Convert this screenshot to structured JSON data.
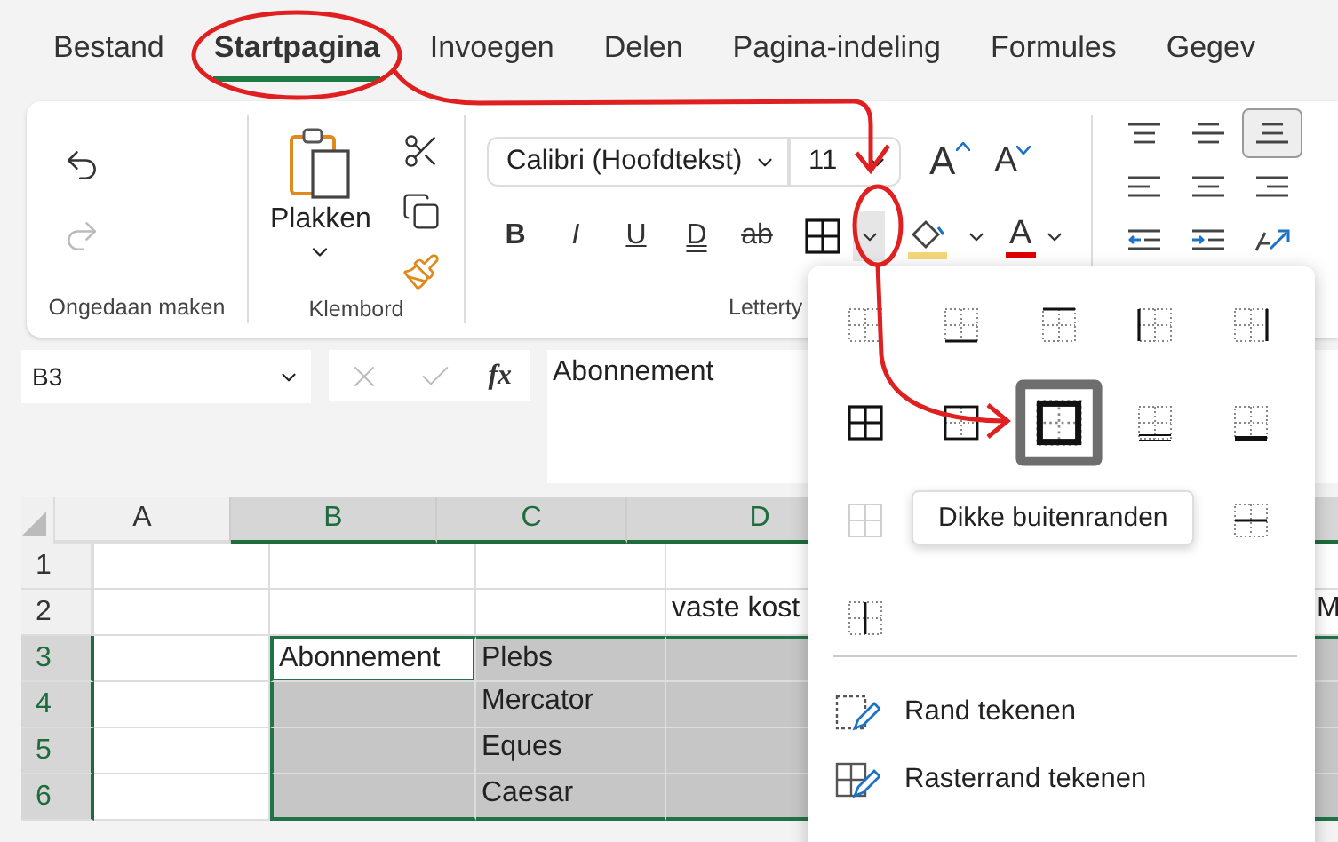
{
  "tabs": [
    {
      "label": "Bestand",
      "selected": false
    },
    {
      "label": "Startpagina",
      "selected": true
    },
    {
      "label": "Invoegen",
      "selected": false
    },
    {
      "label": "Delen",
      "selected": false
    },
    {
      "label": "Pagina-indeling",
      "selected": false
    },
    {
      "label": "Formules",
      "selected": false
    },
    {
      "label": "Gegev",
      "selected": false
    }
  ],
  "ribbon": {
    "undo_group": {
      "label": "Ongedaan maken",
      "actions": [
        {
          "kind": "undo",
          "disabled": false
        },
        {
          "kind": "redo",
          "disabled": true
        }
      ]
    },
    "clipboard_group": {
      "label": "Klembord",
      "paste": "Plakken"
    },
    "font_group": {
      "label": "Letterty",
      "font_name": "Calibri (Hoofdtekst)",
      "font_size": "11",
      "grow": "A",
      "shrink": "A",
      "font_color": "A",
      "border_menu_open": true,
      "styles": [
        {
          "kind": "bold",
          "text": "B"
        },
        {
          "kind": "italic",
          "text": "I"
        },
        {
          "kind": "underline",
          "text": "U"
        },
        {
          "kind": "double_underline",
          "text": "D"
        },
        {
          "kind": "strikethrough",
          "text": "ab"
        }
      ]
    },
    "alignment_group": {
      "buttons": [
        {
          "kind": "top",
          "selected": false
        },
        {
          "kind": "middle",
          "selected": false
        },
        {
          "kind": "bottom",
          "selected": true
        },
        {
          "kind": "left",
          "selected": false
        },
        {
          "kind": "center",
          "selected": false
        },
        {
          "kind": "right",
          "selected": false
        },
        {
          "kind": "indent_decrease",
          "selected": false
        },
        {
          "kind": "indent_increase",
          "selected": false
        },
        {
          "kind": "orientation",
          "selected": false
        }
      ]
    }
  },
  "formula_bar": {
    "name_box": "B3",
    "function_label": "fx",
    "formula": "Abonnement"
  },
  "sheet": {
    "columns": [
      {
        "label": "A",
        "selected": false
      },
      {
        "label": "B",
        "selected": true
      },
      {
        "label": "C",
        "selected": true
      },
      {
        "label": "D",
        "selected": true
      },
      {
        "selected": true
      }
    ],
    "rows": [
      {
        "label": "1",
        "selected": false,
        "cells": [
          {
            "active": false
          },
          {
            "active": false
          },
          {
            "active": false
          },
          {
            "active": false
          },
          {
            "active": false
          }
        ]
      },
      {
        "label": "2",
        "selected": false,
        "cells": [
          {
            "active": false
          },
          {
            "active": false
          },
          {
            "active": false
          },
          {
            "text": "vaste kost",
            "active": false
          },
          {
            "text": "M",
            "active": false
          }
        ]
      },
      {
        "label": "3",
        "selected": true,
        "cells": [
          {
            "active": false
          },
          {
            "text": "Abonnement",
            "active": true
          },
          {
            "text": "Plebs",
            "active": false
          },
          {
            "active": false
          },
          {
            "active": false
          }
        ]
      },
      {
        "label": "4",
        "selected": true,
        "cells": [
          {
            "active": false
          },
          {
            "active": false
          },
          {
            "text": "Mercator",
            "active": false
          },
          {
            "active": false
          },
          {
            "active": false
          }
        ]
      },
      {
        "label": "5",
        "selected": true,
        "cells": [
          {
            "active": false
          },
          {
            "active": false
          },
          {
            "text": "Eques",
            "active": false
          },
          {
            "active": false
          },
          {
            "active": false
          }
        ]
      },
      {
        "label": "6",
        "selected": true,
        "cells": [
          {
            "active": false
          },
          {
            "active": false
          },
          {
            "text": "Caesar",
            "active": false
          },
          {
            "active": false
          },
          {
            "active": false
          }
        ]
      }
    ]
  },
  "border_menu": {
    "rows": [
      [
        {
          "kind": "none",
          "selected": false,
          "disabled": false
        },
        {
          "kind": "bottom",
          "selected": false,
          "disabled": false
        },
        {
          "kind": "top",
          "selected": false,
          "disabled": false
        },
        {
          "kind": "left",
          "selected": false,
          "disabled": false
        },
        {
          "kind": "right",
          "selected": false,
          "disabled": false
        }
      ],
      [
        {
          "kind": "all",
          "selected": false,
          "disabled": false
        },
        {
          "kind": "outside",
          "selected": false,
          "disabled": false
        },
        {
          "kind": "thick_outside",
          "selected": true,
          "disabled": false
        },
        {
          "kind": "bottom_double",
          "selected": false,
          "disabled": false
        },
        {
          "kind": "thick_bottom",
          "selected": false,
          "disabled": false
        }
      ],
      [
        {
          "kind": "inside",
          "selected": false,
          "disabled": true
        },
        {
          "kind": "inside_horizontal",
          "selected": false,
          "disabled": false
        }
      ],
      [
        {
          "kind": "inside_vertical",
          "selected": false,
          "disabled": false
        }
      ]
    ],
    "tooltip": "Dikke buitenranden",
    "items": [
      {
        "kind": "draw",
        "label": "Rand tekenen"
      },
      {
        "kind": "draw_grid",
        "label": "Rasterrand tekenen"
      }
    ]
  }
}
